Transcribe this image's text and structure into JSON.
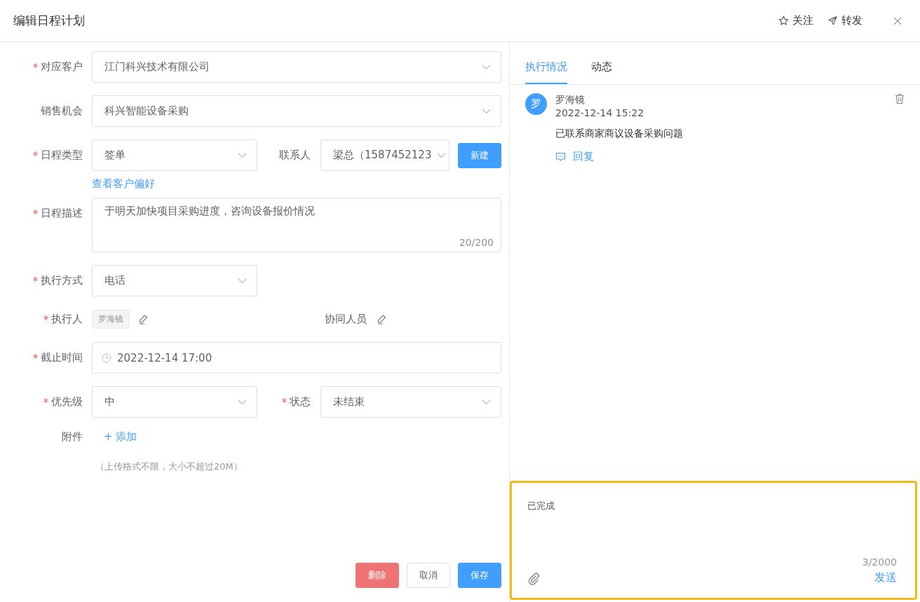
{
  "dialog": {
    "title": "编辑日程计划",
    "actions": [
      {
        "kind": "star",
        "label": "关注"
      },
      {
        "kind": "send",
        "label": "转发"
      }
    ]
  },
  "form": {
    "fields": [
      {
        "kind": "select",
        "label": "对应客户",
        "required": true,
        "value": "江门科兴技术有限公司"
      },
      {
        "kind": "select",
        "label": "销售机会",
        "required": false,
        "value": "科兴智能设备采购"
      },
      {
        "kind": "pair",
        "items": [
          {
            "label": "日程类型",
            "required": true,
            "value": "签单"
          },
          {
            "label": "联系人",
            "required": false,
            "value": "梁总（1587452123"
          }
        ],
        "button": "新建"
      },
      {
        "kind": "link",
        "text": "查看客户偏好"
      },
      {
        "kind": "textarea",
        "label": "日程描述",
        "required": true,
        "value": "于明天加快项目采购进度，咨询设备报价情况",
        "count": "20/200"
      },
      {
        "kind": "half",
        "label": "执行方式",
        "required": true,
        "value": "电话"
      },
      {
        "kind": "people",
        "items": [
          {
            "label": "执行人",
            "required": true,
            "tags": [
              "罗海镜"
            ]
          },
          {
            "label": "协同人员",
            "required": false
          }
        ]
      },
      {
        "kind": "date",
        "label": "截止时间",
        "required": true,
        "value": "2022-12-14 17:00"
      },
      {
        "kind": "pair",
        "items": [
          {
            "label": "优先级",
            "required": true,
            "value": "中"
          },
          {
            "label": "状态",
            "required": true,
            "value": "未结束"
          }
        ]
      },
      {
        "kind": "attachment",
        "label": "附件",
        "action": "+ 添加",
        "hint": "（上传格式不限，大小不超过20M）"
      }
    ],
    "buttons": [
      {
        "kind": "danger",
        "label": "删除"
      },
      {
        "kind": "plain",
        "label": "取消"
      },
      {
        "kind": "primary",
        "label": "保存"
      }
    ]
  },
  "panel": {
    "tabs": [
      {
        "label": "执行情况",
        "selected": true
      },
      {
        "label": "动态",
        "selected": false
      }
    ],
    "comments": [
      {
        "avatar": "罗",
        "author": "罗海镜",
        "time": "2022-12-14 15:22",
        "text": "已联系商家商议设备采购问题",
        "reply": "回复"
      }
    ],
    "composer": {
      "value": "已完成",
      "count": "3/2000",
      "send": "发送"
    }
  }
}
